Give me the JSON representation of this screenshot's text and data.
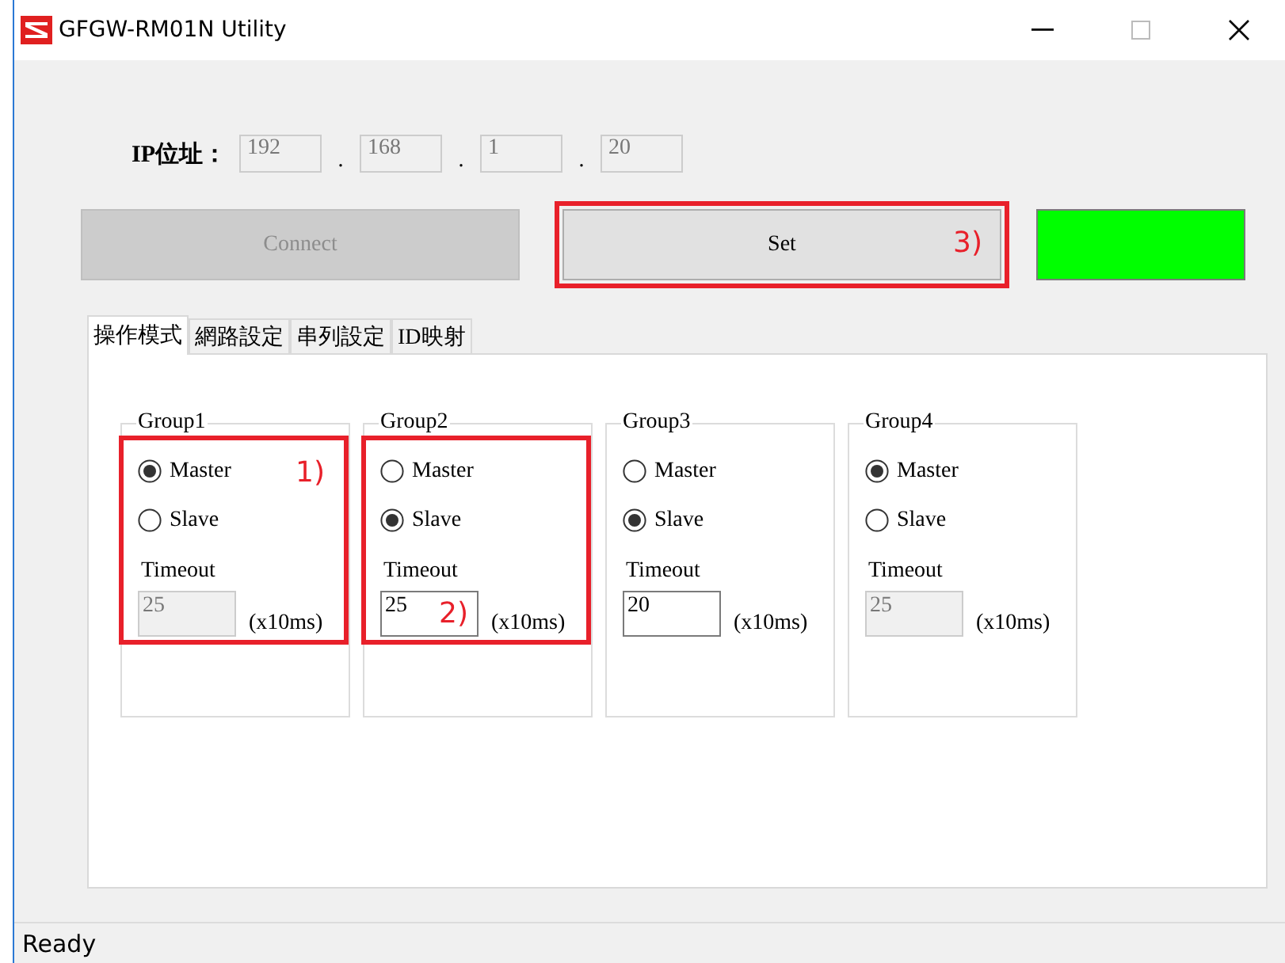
{
  "window": {
    "title": "GFGW-RM01N Utility"
  },
  "ip": {
    "label": "IP位址：",
    "octets": [
      {
        "value": "192",
        "disabled": true
      },
      {
        "value": "168",
        "disabled": true
      },
      {
        "value": "1",
        "disabled": true
      },
      {
        "value": "20",
        "disabled": true
      }
    ],
    "separators": [
      ".",
      ".",
      "."
    ]
  },
  "connect_button": {
    "label": "Connect",
    "disabled": true
  },
  "set_button": {
    "label": "Set",
    "disabled": false,
    "annotation": "3)"
  },
  "status_indicator": {
    "color": "#00ff00"
  },
  "tabs": [
    {
      "label": "操作模式",
      "selected": true
    },
    {
      "label": "網路設定",
      "selected": false
    },
    {
      "label": "串列設定",
      "selected": false
    },
    {
      "label": "ID映射",
      "selected": false
    }
  ],
  "groups": [
    {
      "title": "Group1",
      "options": [
        {
          "label": "Master",
          "selected": true
        },
        {
          "label": "Slave",
          "selected": false
        }
      ],
      "timeout_label": "Timeout",
      "timeout": {
        "value": "25",
        "disabled": true
      },
      "unit": "(x10ms)",
      "annotation": "1)"
    },
    {
      "title": "Group2",
      "options": [
        {
          "label": "Master",
          "selected": false
        },
        {
          "label": "Slave",
          "selected": true
        }
      ],
      "timeout_label": "Timeout",
      "timeout": {
        "value": "25",
        "disabled": false
      },
      "unit": "(x10ms)",
      "annotation": "2)"
    },
    {
      "title": "Group3",
      "options": [
        {
          "label": "Master",
          "selected": false
        },
        {
          "label": "Slave",
          "selected": true
        }
      ],
      "timeout_label": "Timeout",
      "timeout": {
        "value": "20",
        "disabled": false
      },
      "unit": "(x10ms)"
    },
    {
      "title": "Group4",
      "options": [
        {
          "label": "Master",
          "selected": true
        },
        {
          "label": "Slave",
          "selected": false
        }
      ],
      "timeout_label": "Timeout",
      "timeout": {
        "value": "25",
        "disabled": true
      },
      "unit": "(x10ms)"
    }
  ],
  "status_bar": {
    "text": "Ready"
  }
}
